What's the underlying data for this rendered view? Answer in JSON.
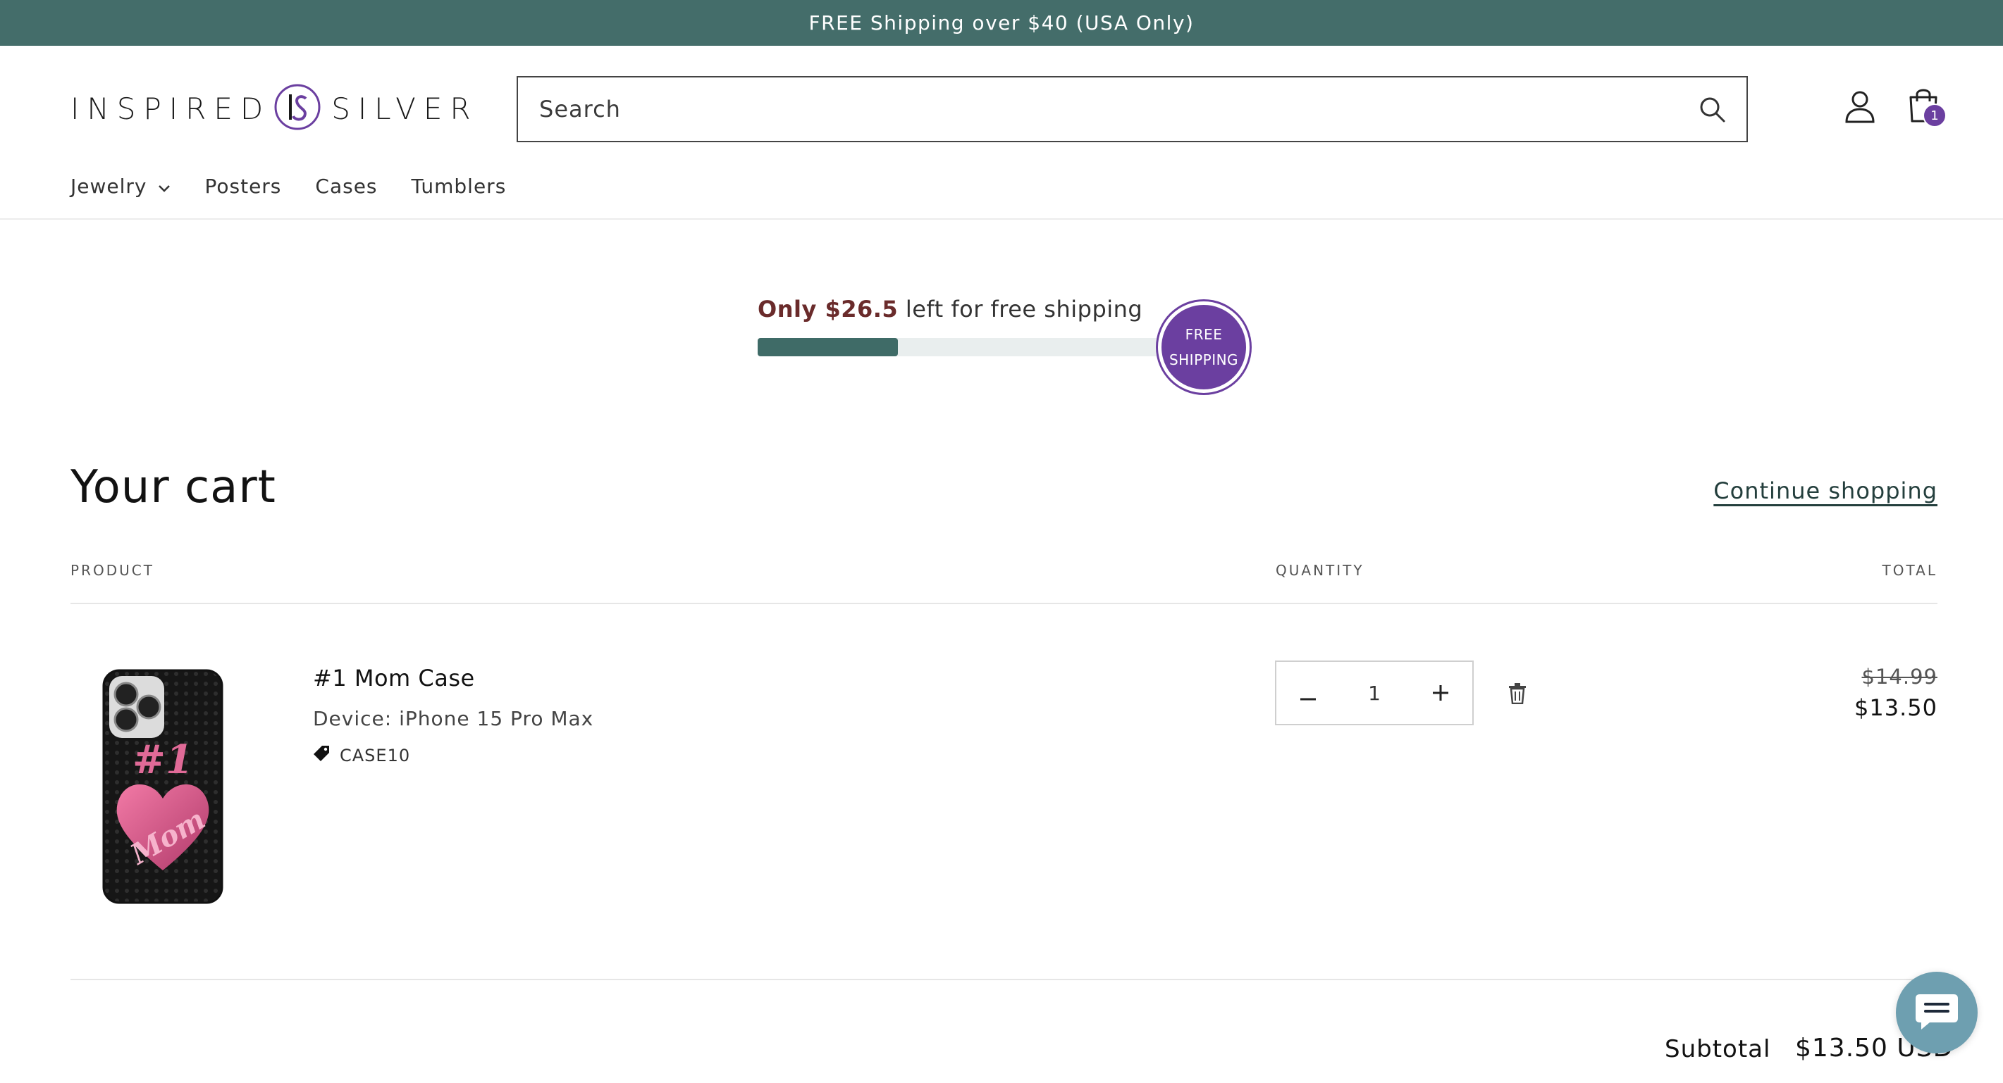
{
  "announcement": "FREE Shipping over $40 (USA Only)",
  "brand": {
    "left": "INSPIRED",
    "right": "SILVER",
    "mark": "IS"
  },
  "search": {
    "placeholder": "Search"
  },
  "header": {
    "cart_count": "1"
  },
  "nav": [
    {
      "label": "Jewelry",
      "has_dropdown": true
    },
    {
      "label": "Posters"
    },
    {
      "label": "Cases"
    },
    {
      "label": "Tumblers"
    }
  ],
  "shipping_bar": {
    "prefix": "Only $26.5",
    "suffix": " left for free shipping",
    "progress_fraction": 0.3375,
    "badge_line1": "FREE",
    "badge_line2": "SHIPPING"
  },
  "cart": {
    "title": "Your cart",
    "continue_label": "Continue shopping",
    "columns": {
      "product": "PRODUCT",
      "quantity": "QUANTITY",
      "total": "TOTAL"
    },
    "items": [
      {
        "name": "#1 Mom Case",
        "variant": "Device: iPhone 15 Pro Max",
        "discount_code": "CASE10",
        "quantity": "1",
        "original_price": "$14.99",
        "price": "$13.50"
      }
    ],
    "subtotal_label": "Subtotal",
    "subtotal_value": "$13.50 USD"
  },
  "colors": {
    "announcement_bg": "#446d6a",
    "accent_purple": "#6b3fa0",
    "progress": "#3f6b67",
    "highlight": "#6a2b2b"
  },
  "icons": [
    "search-icon",
    "account-icon",
    "cart-icon",
    "chevron-down-icon",
    "tag-icon",
    "trash-icon",
    "chat-icon"
  ]
}
